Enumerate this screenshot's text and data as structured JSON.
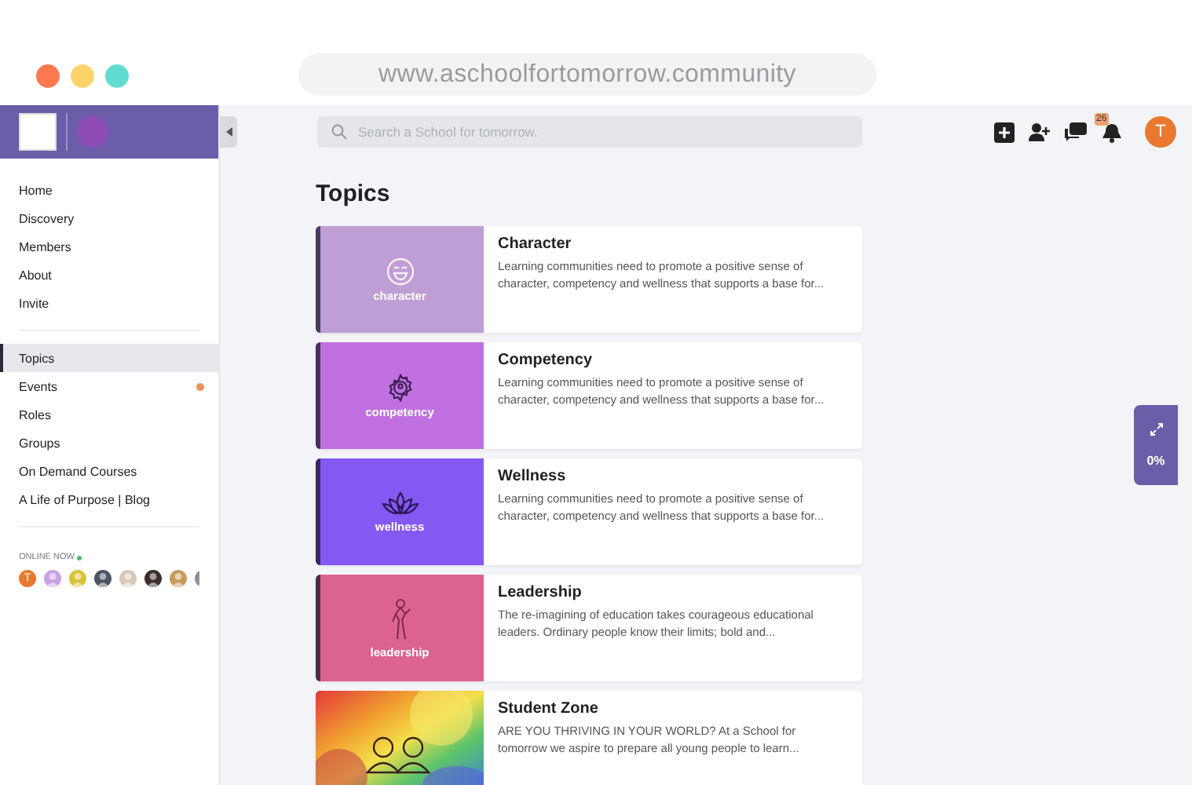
{
  "browser": {
    "url": "www.aschoolfortomorrow.community"
  },
  "sidebar": {
    "sections": [
      {
        "items": [
          {
            "label": "Home",
            "selected": false,
            "unread": false
          },
          {
            "label": "Discovery",
            "selected": false,
            "unread": false
          },
          {
            "label": "Members",
            "selected": false,
            "unread": false
          },
          {
            "label": "About",
            "selected": false,
            "unread": false
          },
          {
            "label": "Invite",
            "selected": false,
            "unread": false
          }
        ]
      },
      {
        "items": [
          {
            "label": "Topics",
            "selected": true,
            "unread": false
          },
          {
            "label": "Events",
            "selected": false,
            "unread": true
          },
          {
            "label": "Roles",
            "selected": false,
            "unread": false
          },
          {
            "label": "Groups",
            "selected": false,
            "unread": false
          },
          {
            "label": "On Demand Courses",
            "selected": false,
            "unread": false
          },
          {
            "label": "A Life of Purpose | Blog",
            "selected": false,
            "unread": false
          }
        ]
      }
    ],
    "online_now": {
      "label": "ONLINE NOW",
      "users": [
        {
          "initial": "T",
          "color": "#e9792f"
        },
        {
          "color": "#c9a2e6"
        },
        {
          "color": "#d8c43a"
        },
        {
          "color": "#4b5563"
        },
        {
          "color": "#d9c7b8"
        },
        {
          "color": "#3a2f2a"
        },
        {
          "color": "#c89b5a"
        },
        {
          "color": "#8a8f99"
        }
      ]
    }
  },
  "search": {
    "placeholder": "Search a School for tomorrow."
  },
  "header": {
    "notifications": "26",
    "avatar": "T"
  },
  "page": {
    "title": "Topics"
  },
  "topics": [
    {
      "title": "Character",
      "kind": "smiley",
      "tile_label": "character",
      "color": "#bf9ed6",
      "description": "Learning communities need to promote a positive sense of character, competency and wellness that supports a base for..."
    },
    {
      "title": "Competency",
      "kind": "gear",
      "tile_label": "competency",
      "color": "#c070e0",
      "description": "Learning communities need to promote a positive sense of character, competency and wellness that supports a base for..."
    },
    {
      "title": "Wellness",
      "kind": "lotus",
      "tile_label": "wellness",
      "color": "#8458f2",
      "description": "Learning communities need to promote a positive sense of character, competency and wellness that supports a base for..."
    },
    {
      "title": "Leadership",
      "kind": "figure",
      "tile_label": "leadership",
      "color": "#dc6391",
      "description": "The re-imagining of education takes courageous educational leaders. Ordinary people know their limits; bold and..."
    },
    {
      "title": "Student Zone",
      "kind": "picture",
      "description": "ARE YOU THRIVING IN YOUR WORLD? At a School for tomorrow we aspire to prepare all young people to learn..."
    }
  ],
  "progress_widget": {
    "reading": "0%"
  }
}
